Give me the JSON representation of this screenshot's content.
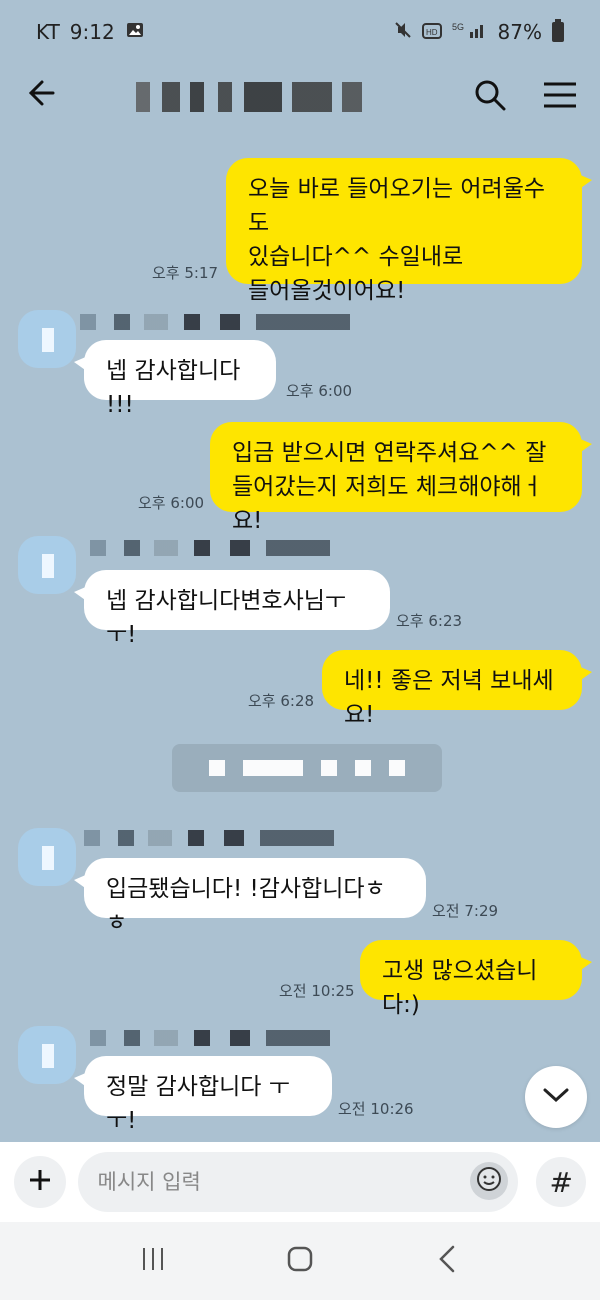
{
  "status_bar": {
    "carrier": "KT",
    "time": "9:12",
    "battery": "87%"
  },
  "header": {
    "title": ""
  },
  "messages": [
    {
      "sender": "me",
      "text": "오늘 바로 들어오기는 어려울수도\n있습니다^^ 수일내로\n들어올것이어요!",
      "time": "오후 5:17"
    },
    {
      "sender": "other",
      "text": "넵 감사합니다 !!!",
      "time": "오후 6:00"
    },
    {
      "sender": "me",
      "text": "입금 받으시면 연락주셔요^^ 잘\n들어갔는지 저희도 체크해야해ㅓ요!",
      "time": "오후 6:00"
    },
    {
      "sender": "other",
      "text": "넵 감사합니다변호사님ㅜㅜ!",
      "time": "오후 6:23"
    },
    {
      "sender": "me",
      "text": "네!! 좋은 저녁 보내세요!",
      "time": "오후 6:28"
    },
    {
      "sender": "other",
      "text": "입금됐습니다!  !감사합니다ㅎㅎ",
      "time": "오전 7:29"
    },
    {
      "sender": "me",
      "text": "고생 많으셨습니다:)",
      "time": "오전 10:25"
    },
    {
      "sender": "other",
      "text": "정말 감사합니다 ㅜㅜ!",
      "time": "오전 10:26"
    }
  ],
  "input": {
    "placeholder": "메시지 입력",
    "hash_label": "#"
  },
  "icons": {
    "back": "back-arrow-icon",
    "search": "search-icon",
    "menu": "hamburger-menu-icon",
    "plus": "plus-icon",
    "emoji": "emoji-icon",
    "scroll_down": "chevron-down-icon",
    "nav_recent": "recent-apps-icon",
    "nav_home": "home-icon",
    "nav_back": "back-icon"
  },
  "colors": {
    "chat_background": "#abc1d1",
    "my_bubble": "#fee500",
    "other_bubble": "#ffffff"
  }
}
